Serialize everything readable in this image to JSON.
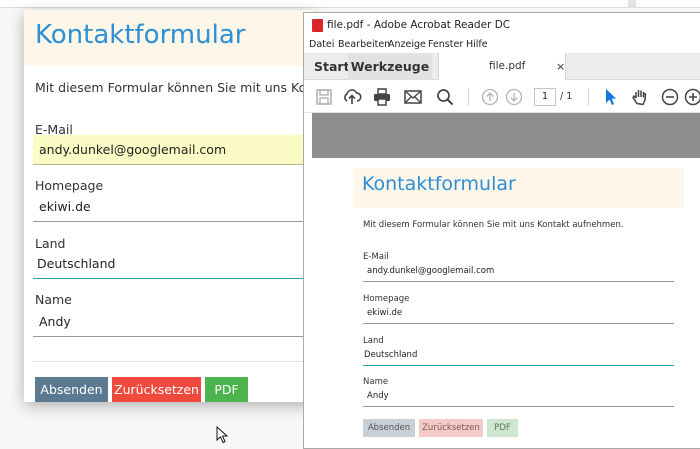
{
  "colors": {
    "web_title": "#2d8fd6",
    "header_bg": "#fdf6e9",
    "autofill_bg": "#fbfbc6",
    "btn_send": "#5b7a91",
    "btn_reset": "#f04a3e",
    "btn_pdf": "#4cb44c",
    "acrobat_red": "#d8262b",
    "toolbar_blue": "#1473e6"
  },
  "webform": {
    "title": "Kontaktformular",
    "intro": "Mit diesem Formular können Sie mit uns Kontakt aufnehmen.",
    "fields": [
      {
        "label": "E-Mail",
        "value": "andy.dunkel@googlemail.com"
      },
      {
        "label": "Homepage",
        "value": "ekiwi.de"
      },
      {
        "label": "Land",
        "value": "Deutschland"
      },
      {
        "label": "Name",
        "value": "Andy"
      }
    ],
    "buttons": {
      "send": "Absenden",
      "reset": "Zurücksetzen",
      "pdf": "PDF"
    }
  },
  "acrobat": {
    "window_title": "file.pdf - Adobe Acrobat Reader DC",
    "menu": [
      "Datei",
      "Bearbeiten",
      "Anzeige",
      "Fenster",
      "Hilfe"
    ],
    "tabs": {
      "start": "Start",
      "tools": "Werkzeuge",
      "file": "file.pdf",
      "close": "×"
    },
    "toolbar": {
      "icons": [
        "save-icon",
        "upload-icon",
        "print-icon",
        "mail-icon",
        "search-icon",
        "page-up-icon",
        "page-down-icon",
        "pointer-icon",
        "hand-icon",
        "zoom-out-icon",
        "zoom-in-icon"
      ],
      "current_page": "1",
      "page_total": "/ 1"
    },
    "pdf": {
      "title": "Kontaktformular",
      "intro": "Mit diesem Formular können Sie mit uns Kontakt aufnehmen.",
      "fields": [
        {
          "label": "E-Mail",
          "value": "andy.dunkel@googlemail.com"
        },
        {
          "label": "Homepage",
          "value": "ekiwi.de"
        },
        {
          "label": "Land",
          "value": "Deutschland"
        },
        {
          "label": "Name",
          "value": "Andy"
        }
      ],
      "buttons": {
        "send": "Absenden",
        "reset": "Zurücksetzen",
        "pdf": "PDF"
      }
    }
  }
}
